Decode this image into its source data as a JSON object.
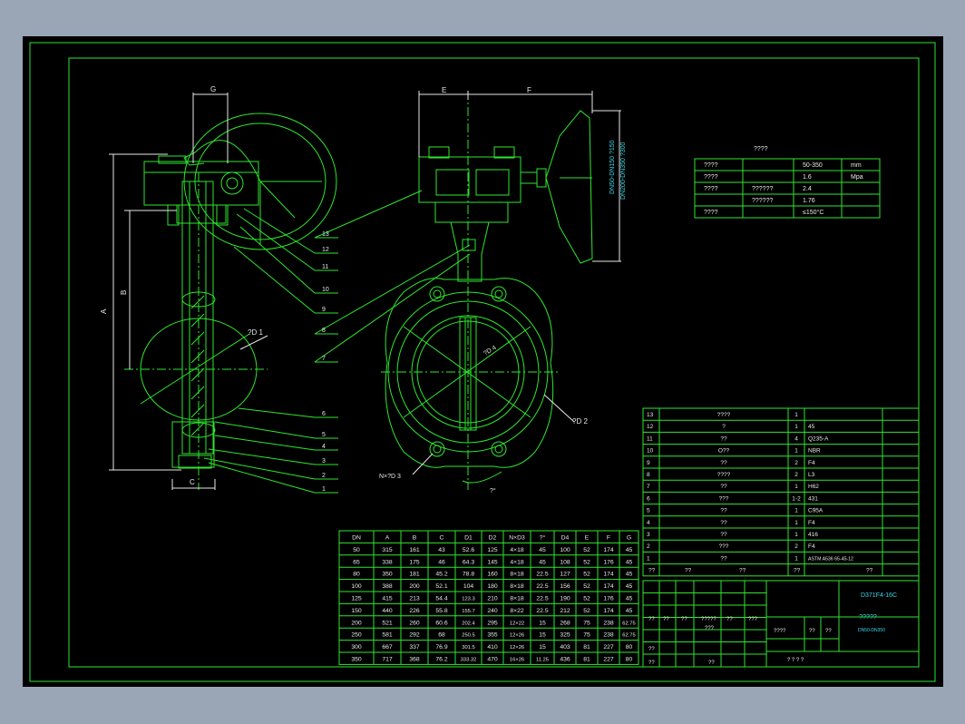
{
  "colors": {
    "background": "#000000",
    "frame": "#2ee62e",
    "dim": "#e8e8e8",
    "label": "#3ad7e6",
    "outside": "#9aa5b6"
  },
  "drawing": {
    "dims_left": {
      "G": "G",
      "A": "A",
      "B": "B",
      "C": "C",
      "D1": "?D 1"
    },
    "dims_front": {
      "E": "E",
      "F": "F",
      "D4": "?D 4",
      "D2": "?D 2",
      "NxD3": "N×?D 3",
      "angle": "?°"
    },
    "handwheel_notes": [
      "DN50-DN150 ?150",
      "DN200-DN350 ?300"
    ],
    "balloons": [
      "13",
      "12",
      "11",
      "10",
      "9",
      "8",
      "7",
      "6",
      "5",
      "4",
      "3",
      "2",
      "1"
    ]
  },
  "spec_table": {
    "title": "????",
    "rows": [
      [
        "????",
        "",
        "50-350",
        "mm"
      ],
      [
        "????",
        "",
        "1.6",
        "Mpa"
      ],
      [
        "????",
        "??????",
        "2.4",
        ""
      ],
      [
        "",
        "??????",
        "1.76",
        ""
      ],
      [
        "????",
        "",
        "≤150°C",
        ""
      ]
    ]
  },
  "dim_table": {
    "headers": [
      "DN",
      "A",
      "B",
      "C",
      "D1",
      "D2",
      "N×D3",
      "?°",
      "D4",
      "E",
      "F",
      "G"
    ],
    "rows": [
      [
        "50",
        "315",
        "161",
        "43",
        "52.6",
        "125",
        "4×18",
        "45",
        "100",
        "52",
        "174",
        "45"
      ],
      [
        "65",
        "338",
        "175",
        "46",
        "64.3",
        "145",
        "4×18",
        "45",
        "108",
        "52",
        "176",
        "45"
      ],
      [
        "80",
        "350",
        "181",
        "45.2",
        "78.8",
        "160",
        "8×18",
        "22.5",
        "127",
        "52",
        "174",
        "45"
      ],
      [
        "100",
        "388",
        "200",
        "52.1",
        "104",
        "180",
        "8×18",
        "22.5",
        "156",
        "52",
        "174",
        "45"
      ],
      [
        "125",
        "415",
        "213",
        "54.4",
        "123.3",
        "210",
        "8×18",
        "22.5",
        "190",
        "52",
        "176",
        "45"
      ],
      [
        "150",
        "440",
        "226",
        "55.8",
        "155.7",
        "240",
        "8×22",
        "22.5",
        "212",
        "52",
        "174",
        "45"
      ],
      [
        "200",
        "521",
        "260",
        "60.6",
        "202.4",
        "295",
        "12×22",
        "15",
        "268",
        "75",
        "238",
        "62.75"
      ],
      [
        "250",
        "581",
        "292",
        "68",
        "250.5",
        "355",
        "12×26",
        "15",
        "325",
        "75",
        "238",
        "62.75"
      ],
      [
        "300",
        "667",
        "337",
        "76.9",
        "301.5",
        "410",
        "12×26",
        "15",
        "403",
        "81",
        "227",
        "80"
      ],
      [
        "350",
        "717",
        "368",
        "76.2",
        "333.32",
        "470",
        "16×26",
        "11.25",
        "436",
        "81",
        "227",
        "80"
      ]
    ]
  },
  "parts_table": {
    "rows": [
      [
        "13",
        "????",
        "1",
        ""
      ],
      [
        "12",
        "?",
        "1",
        "45"
      ],
      [
        "11",
        "??",
        "4",
        "Q235-A"
      ],
      [
        "10",
        "O??",
        "1",
        "NBR"
      ],
      [
        "9",
        "??",
        "2",
        "F4"
      ],
      [
        "8",
        "????",
        "2",
        "L3"
      ],
      [
        "7",
        "??",
        "1",
        "H62"
      ],
      [
        "6",
        "???",
        "1-2",
        "431"
      ],
      [
        "5",
        "??",
        "1",
        "C95A"
      ],
      [
        "4",
        "??",
        "1",
        "F4"
      ],
      [
        "3",
        "??",
        "1",
        "416"
      ],
      [
        "2",
        "???",
        "2",
        "F4"
      ],
      [
        "1",
        "??",
        "1",
        "ASTM A536 65-45-12"
      ]
    ],
    "header": [
      "??",
      "??",
      "??",
      "??",
      "??"
    ]
  },
  "title_block": {
    "drawing_no": "D371F4-16C",
    "name": "?????",
    "range": "DN50-DN350",
    "marks": [
      "??",
      "??",
      "??",
      "?????",
      "??",
      "???"
    ],
    "sign_row": [
      "????",
      "??",
      "??"
    ],
    "bottom": "? ? ? ?",
    "left_cells": [
      "??",
      "???",
      "??",
      "??"
    ]
  }
}
